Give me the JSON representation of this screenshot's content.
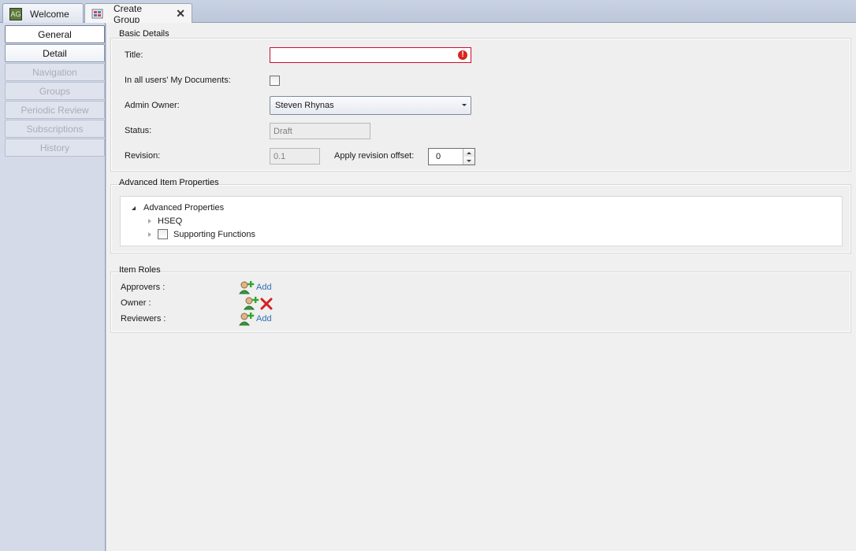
{
  "tabs": [
    {
      "label": "Welcome",
      "icon": "app-logo-icon",
      "icon_text": "AG"
    },
    {
      "label": "Create Group",
      "icon": "group-icon",
      "close": "✕"
    }
  ],
  "nav": {
    "items": [
      {
        "label": "General",
        "state": "selected"
      },
      {
        "label": "Detail",
        "state": "enabled"
      },
      {
        "label": "Navigation",
        "state": "disabled"
      },
      {
        "label": "Groups",
        "state": "disabled"
      },
      {
        "label": "Periodic Review",
        "state": "disabled"
      },
      {
        "label": "Subscriptions",
        "state": "disabled"
      },
      {
        "label": "History",
        "state": "disabled"
      }
    ]
  },
  "basic": {
    "title": "Basic Details",
    "title_label": "Title:",
    "title_value": "",
    "mydocs_label": "In all users' My Documents:",
    "admin_label": "Admin Owner:",
    "admin_value": "Steven Rhynas",
    "status_label": "Status:",
    "status_value": "Draft",
    "revision_label": "Revision:",
    "revision_value": "0.1",
    "offset_label": "Apply revision offset:",
    "offset_value": "0"
  },
  "advanced": {
    "title": "Advanced Item Properties",
    "root": "Advanced Properties",
    "children": [
      "HSEQ",
      "Supporting Functions"
    ]
  },
  "roles": {
    "title": "Item Roles",
    "approvers_label": "Approvers :",
    "owner_label": "Owner :",
    "reviewers_label": "Reviewers :",
    "add_label": "Add"
  },
  "colors": {
    "error": "#d8261f",
    "link": "#2f6fb6",
    "nav_bg": "#d5dae8"
  }
}
